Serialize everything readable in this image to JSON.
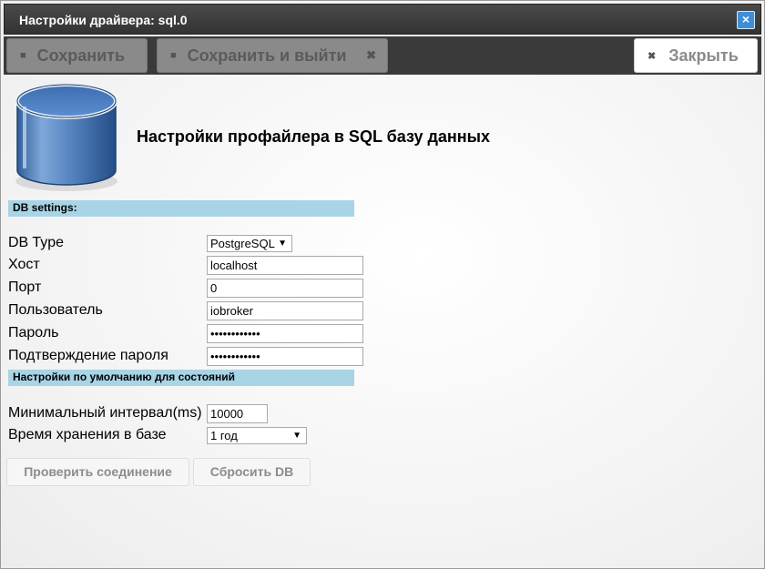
{
  "window": {
    "title": "Настройки драйвера: sql.0"
  },
  "toolbar": {
    "save_label": "Сохранить",
    "save_exit_label": "Сохранить и выйти",
    "close_label": "Закрыть"
  },
  "heading": "Настройки профайлера в SQL базу данных",
  "sections": {
    "db_settings": "DB settings:",
    "defaults": "Настройки по умолчанию для состояний"
  },
  "form": {
    "db_type": {
      "label": "DB Type",
      "value": "PostgreSQL"
    },
    "host": {
      "label": "Хост",
      "value": "localhost"
    },
    "port": {
      "label": "Порт",
      "value": "0"
    },
    "user": {
      "label": "Пользователь",
      "value": "iobroker"
    },
    "password": {
      "label": "Пароль",
      "value": "••••••••••••"
    },
    "password_confirm": {
      "label": "Подтверждение пароля",
      "value": "••••••••••••"
    },
    "min_interval": {
      "label": "Минимальный интервал(ms)",
      "value": "10000"
    },
    "retention": {
      "label": "Время хранения в базе",
      "value": "1 год"
    }
  },
  "buttons": {
    "test_connection": "Проверить соединение",
    "reset_db": "Сбросить DB"
  },
  "colors": {
    "titlebar": "#3a3a3a",
    "section_bar": "#a8d4e6",
    "close_accent": "#3f8ed8"
  }
}
